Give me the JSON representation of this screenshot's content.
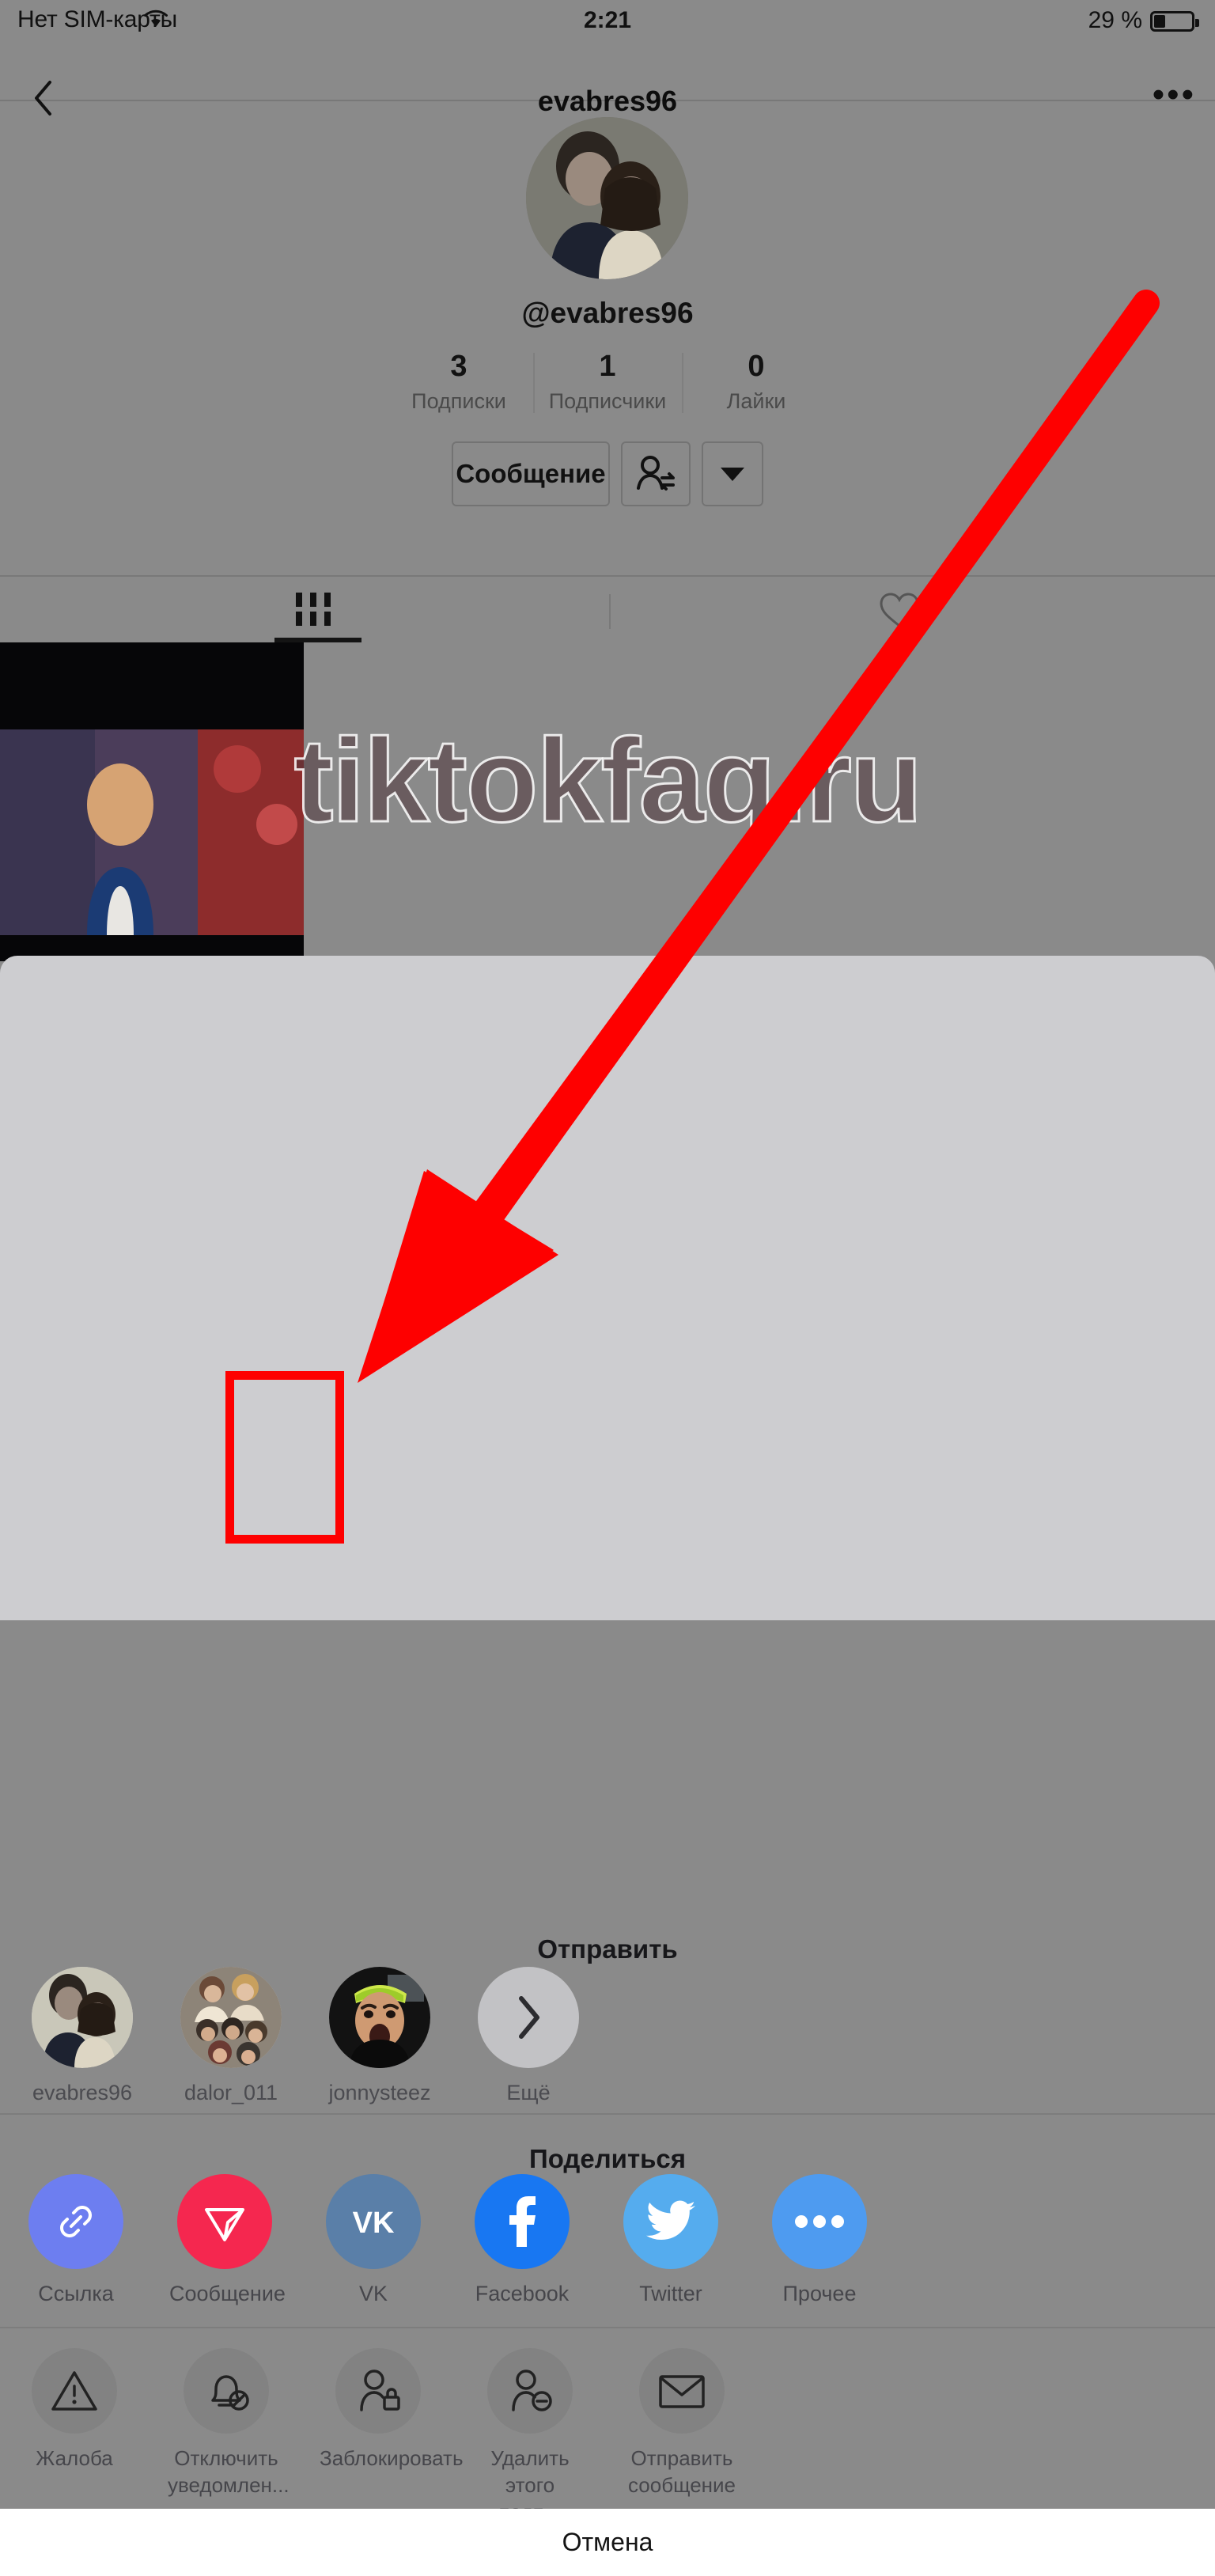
{
  "status_bar": {
    "carrier": "Нет SIM-карты",
    "wifi_icon": "wifi-icon",
    "time": "2:21",
    "battery_percent": "29 %",
    "battery_icon": "battery-icon"
  },
  "nav": {
    "back_icon": "chevron-left-icon",
    "title": "evabres96",
    "more_icon": "ellipsis-icon",
    "more_label": "•••"
  },
  "profile": {
    "avatar_name": "profile-avatar",
    "handle": "@evabres96",
    "stats": [
      {
        "value": "3",
        "label": "Подписки"
      },
      {
        "value": "1",
        "label": "Подписчики"
      },
      {
        "value": "0",
        "label": "Лайки"
      }
    ],
    "message_button": "Сообщение",
    "follow_icon": "person-swap-icon",
    "dropdown_icon": "chevron-down-icon"
  },
  "tabs": {
    "grid_icon": "grid-icon",
    "liked_icon": "heart-icon"
  },
  "watermark": "tiktokfaq.ru",
  "share_sheet": {
    "send_title": "Отправить",
    "send_items": [
      {
        "label": "evabres96",
        "avatar": "avatar-evabres96"
      },
      {
        "label": "dalor_011",
        "avatar": "avatar-dalor011"
      },
      {
        "label": "jonnysteez",
        "avatar": "avatar-jonnysteez"
      },
      {
        "label": "Ещё",
        "avatar": "chevron-right-icon"
      }
    ],
    "share_title": "Поделиться",
    "share_items": [
      {
        "label": "Ссылка",
        "icon": "link-icon",
        "color": "#6d7ef0"
      },
      {
        "label": "Сообщение",
        "icon": "telegram-send-icon",
        "color": "#f5274f"
      },
      {
        "label": "VK",
        "icon": "vk-icon",
        "color": "#5a7fa8"
      },
      {
        "label": "Facebook",
        "icon": "facebook-icon",
        "color": "#1877f2"
      },
      {
        "label": "Twitter",
        "icon": "twitter-icon",
        "color": "#55acee"
      },
      {
        "label": "Прочее",
        "icon": "ellipsis-icon",
        "color": "#4e9bf0"
      }
    ],
    "tool_items": [
      {
        "label": "Жалоба",
        "icon": "warning-triangle-icon"
      },
      {
        "label": "Отключить уведомлен...",
        "icon": "bell-off-icon"
      },
      {
        "label": "Заблокировать",
        "icon": "person-lock-icon",
        "highlighted": true
      },
      {
        "label": "Удалить этого подп...",
        "icon": "person-minus-icon"
      },
      {
        "label": "Отправить сообщение",
        "icon": "envelope-icon"
      }
    ],
    "cancel_label": "Отмена"
  },
  "annotations": {
    "arrow_color": "#fe0000",
    "highlight_color": "#fe0000",
    "arrow_name": "red-pointer-arrow",
    "highlight_name": "red-highlight-box"
  }
}
